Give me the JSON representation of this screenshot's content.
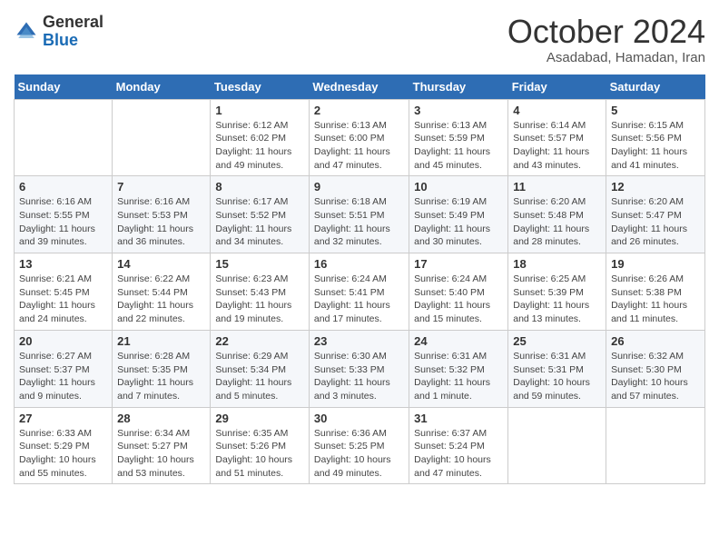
{
  "logo": {
    "general": "General",
    "blue": "Blue"
  },
  "title": "October 2024",
  "subtitle": "Asadabad, Hamadan, Iran",
  "days_header": [
    "Sunday",
    "Monday",
    "Tuesday",
    "Wednesday",
    "Thursday",
    "Friday",
    "Saturday"
  ],
  "weeks": [
    [
      {
        "day": "",
        "info": ""
      },
      {
        "day": "",
        "info": ""
      },
      {
        "day": "1",
        "info": "Sunrise: 6:12 AM\nSunset: 6:02 PM\nDaylight: 11 hours and 49 minutes."
      },
      {
        "day": "2",
        "info": "Sunrise: 6:13 AM\nSunset: 6:00 PM\nDaylight: 11 hours and 47 minutes."
      },
      {
        "day": "3",
        "info": "Sunrise: 6:13 AM\nSunset: 5:59 PM\nDaylight: 11 hours and 45 minutes."
      },
      {
        "day": "4",
        "info": "Sunrise: 6:14 AM\nSunset: 5:57 PM\nDaylight: 11 hours and 43 minutes."
      },
      {
        "day": "5",
        "info": "Sunrise: 6:15 AM\nSunset: 5:56 PM\nDaylight: 11 hours and 41 minutes."
      }
    ],
    [
      {
        "day": "6",
        "info": "Sunrise: 6:16 AM\nSunset: 5:55 PM\nDaylight: 11 hours and 39 minutes."
      },
      {
        "day": "7",
        "info": "Sunrise: 6:16 AM\nSunset: 5:53 PM\nDaylight: 11 hours and 36 minutes."
      },
      {
        "day": "8",
        "info": "Sunrise: 6:17 AM\nSunset: 5:52 PM\nDaylight: 11 hours and 34 minutes."
      },
      {
        "day": "9",
        "info": "Sunrise: 6:18 AM\nSunset: 5:51 PM\nDaylight: 11 hours and 32 minutes."
      },
      {
        "day": "10",
        "info": "Sunrise: 6:19 AM\nSunset: 5:49 PM\nDaylight: 11 hours and 30 minutes."
      },
      {
        "day": "11",
        "info": "Sunrise: 6:20 AM\nSunset: 5:48 PM\nDaylight: 11 hours and 28 minutes."
      },
      {
        "day": "12",
        "info": "Sunrise: 6:20 AM\nSunset: 5:47 PM\nDaylight: 11 hours and 26 minutes."
      }
    ],
    [
      {
        "day": "13",
        "info": "Sunrise: 6:21 AM\nSunset: 5:45 PM\nDaylight: 11 hours and 24 minutes."
      },
      {
        "day": "14",
        "info": "Sunrise: 6:22 AM\nSunset: 5:44 PM\nDaylight: 11 hours and 22 minutes."
      },
      {
        "day": "15",
        "info": "Sunrise: 6:23 AM\nSunset: 5:43 PM\nDaylight: 11 hours and 19 minutes."
      },
      {
        "day": "16",
        "info": "Sunrise: 6:24 AM\nSunset: 5:41 PM\nDaylight: 11 hours and 17 minutes."
      },
      {
        "day": "17",
        "info": "Sunrise: 6:24 AM\nSunset: 5:40 PM\nDaylight: 11 hours and 15 minutes."
      },
      {
        "day": "18",
        "info": "Sunrise: 6:25 AM\nSunset: 5:39 PM\nDaylight: 11 hours and 13 minutes."
      },
      {
        "day": "19",
        "info": "Sunrise: 6:26 AM\nSunset: 5:38 PM\nDaylight: 11 hours and 11 minutes."
      }
    ],
    [
      {
        "day": "20",
        "info": "Sunrise: 6:27 AM\nSunset: 5:37 PM\nDaylight: 11 hours and 9 minutes."
      },
      {
        "day": "21",
        "info": "Sunrise: 6:28 AM\nSunset: 5:35 PM\nDaylight: 11 hours and 7 minutes."
      },
      {
        "day": "22",
        "info": "Sunrise: 6:29 AM\nSunset: 5:34 PM\nDaylight: 11 hours and 5 minutes."
      },
      {
        "day": "23",
        "info": "Sunrise: 6:30 AM\nSunset: 5:33 PM\nDaylight: 11 hours and 3 minutes."
      },
      {
        "day": "24",
        "info": "Sunrise: 6:31 AM\nSunset: 5:32 PM\nDaylight: 11 hours and 1 minute."
      },
      {
        "day": "25",
        "info": "Sunrise: 6:31 AM\nSunset: 5:31 PM\nDaylight: 10 hours and 59 minutes."
      },
      {
        "day": "26",
        "info": "Sunrise: 6:32 AM\nSunset: 5:30 PM\nDaylight: 10 hours and 57 minutes."
      }
    ],
    [
      {
        "day": "27",
        "info": "Sunrise: 6:33 AM\nSunset: 5:29 PM\nDaylight: 10 hours and 55 minutes."
      },
      {
        "day": "28",
        "info": "Sunrise: 6:34 AM\nSunset: 5:27 PM\nDaylight: 10 hours and 53 minutes."
      },
      {
        "day": "29",
        "info": "Sunrise: 6:35 AM\nSunset: 5:26 PM\nDaylight: 10 hours and 51 minutes."
      },
      {
        "day": "30",
        "info": "Sunrise: 6:36 AM\nSunset: 5:25 PM\nDaylight: 10 hours and 49 minutes."
      },
      {
        "day": "31",
        "info": "Sunrise: 6:37 AM\nSunset: 5:24 PM\nDaylight: 10 hours and 47 minutes."
      },
      {
        "day": "",
        "info": ""
      },
      {
        "day": "",
        "info": ""
      }
    ]
  ]
}
